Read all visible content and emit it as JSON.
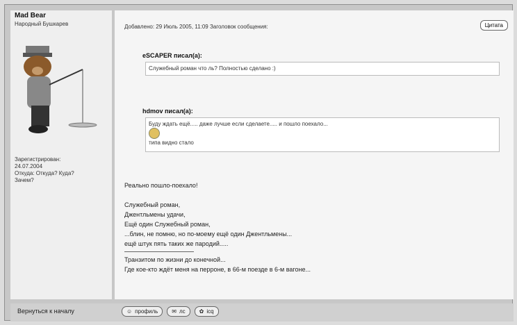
{
  "user": {
    "name": "Mad Bear",
    "rank": "Народный Бушкарев",
    "info": [
      "Зарегистрирован:",
      "24.07.2004",
      "Откуда: Откуда? Куда?",
      "Зачем?"
    ]
  },
  "post": {
    "meta": "Добавлено: 29 Июль 2005, 11:09   Заголовок сообщения:",
    "quote_button": "Цитата"
  },
  "quotes": [
    {
      "author": "eSCAPER писал(а):",
      "text": [
        "Служебный роман что ль? Полностью сделано :)"
      ]
    },
    {
      "author": "hdmov писал(а):",
      "text": [
        "Буду ждать ещё..... даже лучше если сделаете..... и пошло поехало...",
        "типа видно стало"
      ]
    }
  ],
  "body": {
    "lines1": [
      "Реально пошло-поехало!"
    ],
    "lines2": [
      "Служебный роман,",
      "Джентльмены удачи,",
      "Ещё один Служебный роман,",
      "...блин, не помню, но по-моему ещё один Джентльмены...",
      "ещё штук пять таких же пародий....."
    ],
    "signature": [
      "Транзитом по жизни до конечной...",
      "Где кое-кто ждёт меня на перроне, в 66-м поезде в 6-м вагоне..."
    ]
  },
  "footer": {
    "back_link": "Вернуться к началу",
    "buttons": [
      "профиль",
      "лс",
      "icq"
    ]
  }
}
